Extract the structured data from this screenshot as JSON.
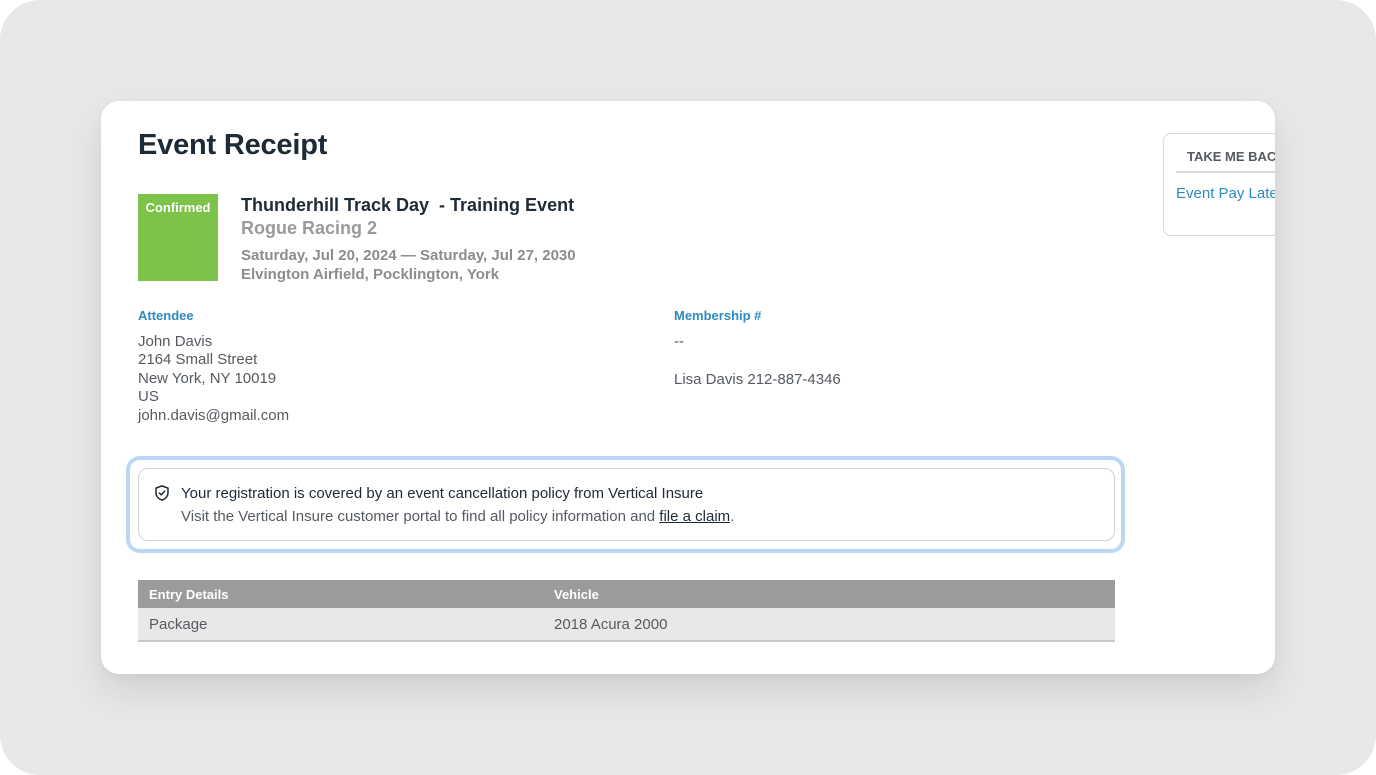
{
  "receipt": {
    "title": "Event Receipt",
    "status": "Confirmed",
    "status_color": "#7dc34a",
    "event": {
      "title": "Thunderhill Track Day  - Training Event",
      "organization": "Rogue Racing 2",
      "dates": "Saturday, Jul 20, 2024 — Saturday, Jul 27, 2030",
      "location": "Elvington Airfield, Pocklington, York"
    },
    "attendee": {
      "label": "Attendee",
      "lines": [
        "John Davis",
        "2164 Small Street",
        "New York, NY 10019",
        "US",
        "john.davis@gmail.com"
      ]
    },
    "membership": {
      "label": "Membership #",
      "value": "--",
      "emergency_contact": "Lisa Davis 212-887-4346"
    },
    "policy": {
      "icon": "shield-check-icon",
      "title": "Your registration is covered by an event cancellation policy from Vertical Insure",
      "text": "Visit the Vertical Insure customer portal to find all policy information and ",
      "link_text": "file a claim",
      "suffix": "."
    },
    "entry_table": {
      "headers": [
        "Entry Details",
        "Vehicle"
      ],
      "rows": [
        [
          "Package",
          "2018 Acura 2000"
        ]
      ]
    }
  },
  "side_panel": {
    "heading": "TAKE ME BACK",
    "link": "Event Pay Later"
  },
  "colors": {
    "accent": "#2e8bc0",
    "heading": "#1f2a37",
    "table_header": "#9b9b9b",
    "highlight_border": "#bcd6f5"
  }
}
